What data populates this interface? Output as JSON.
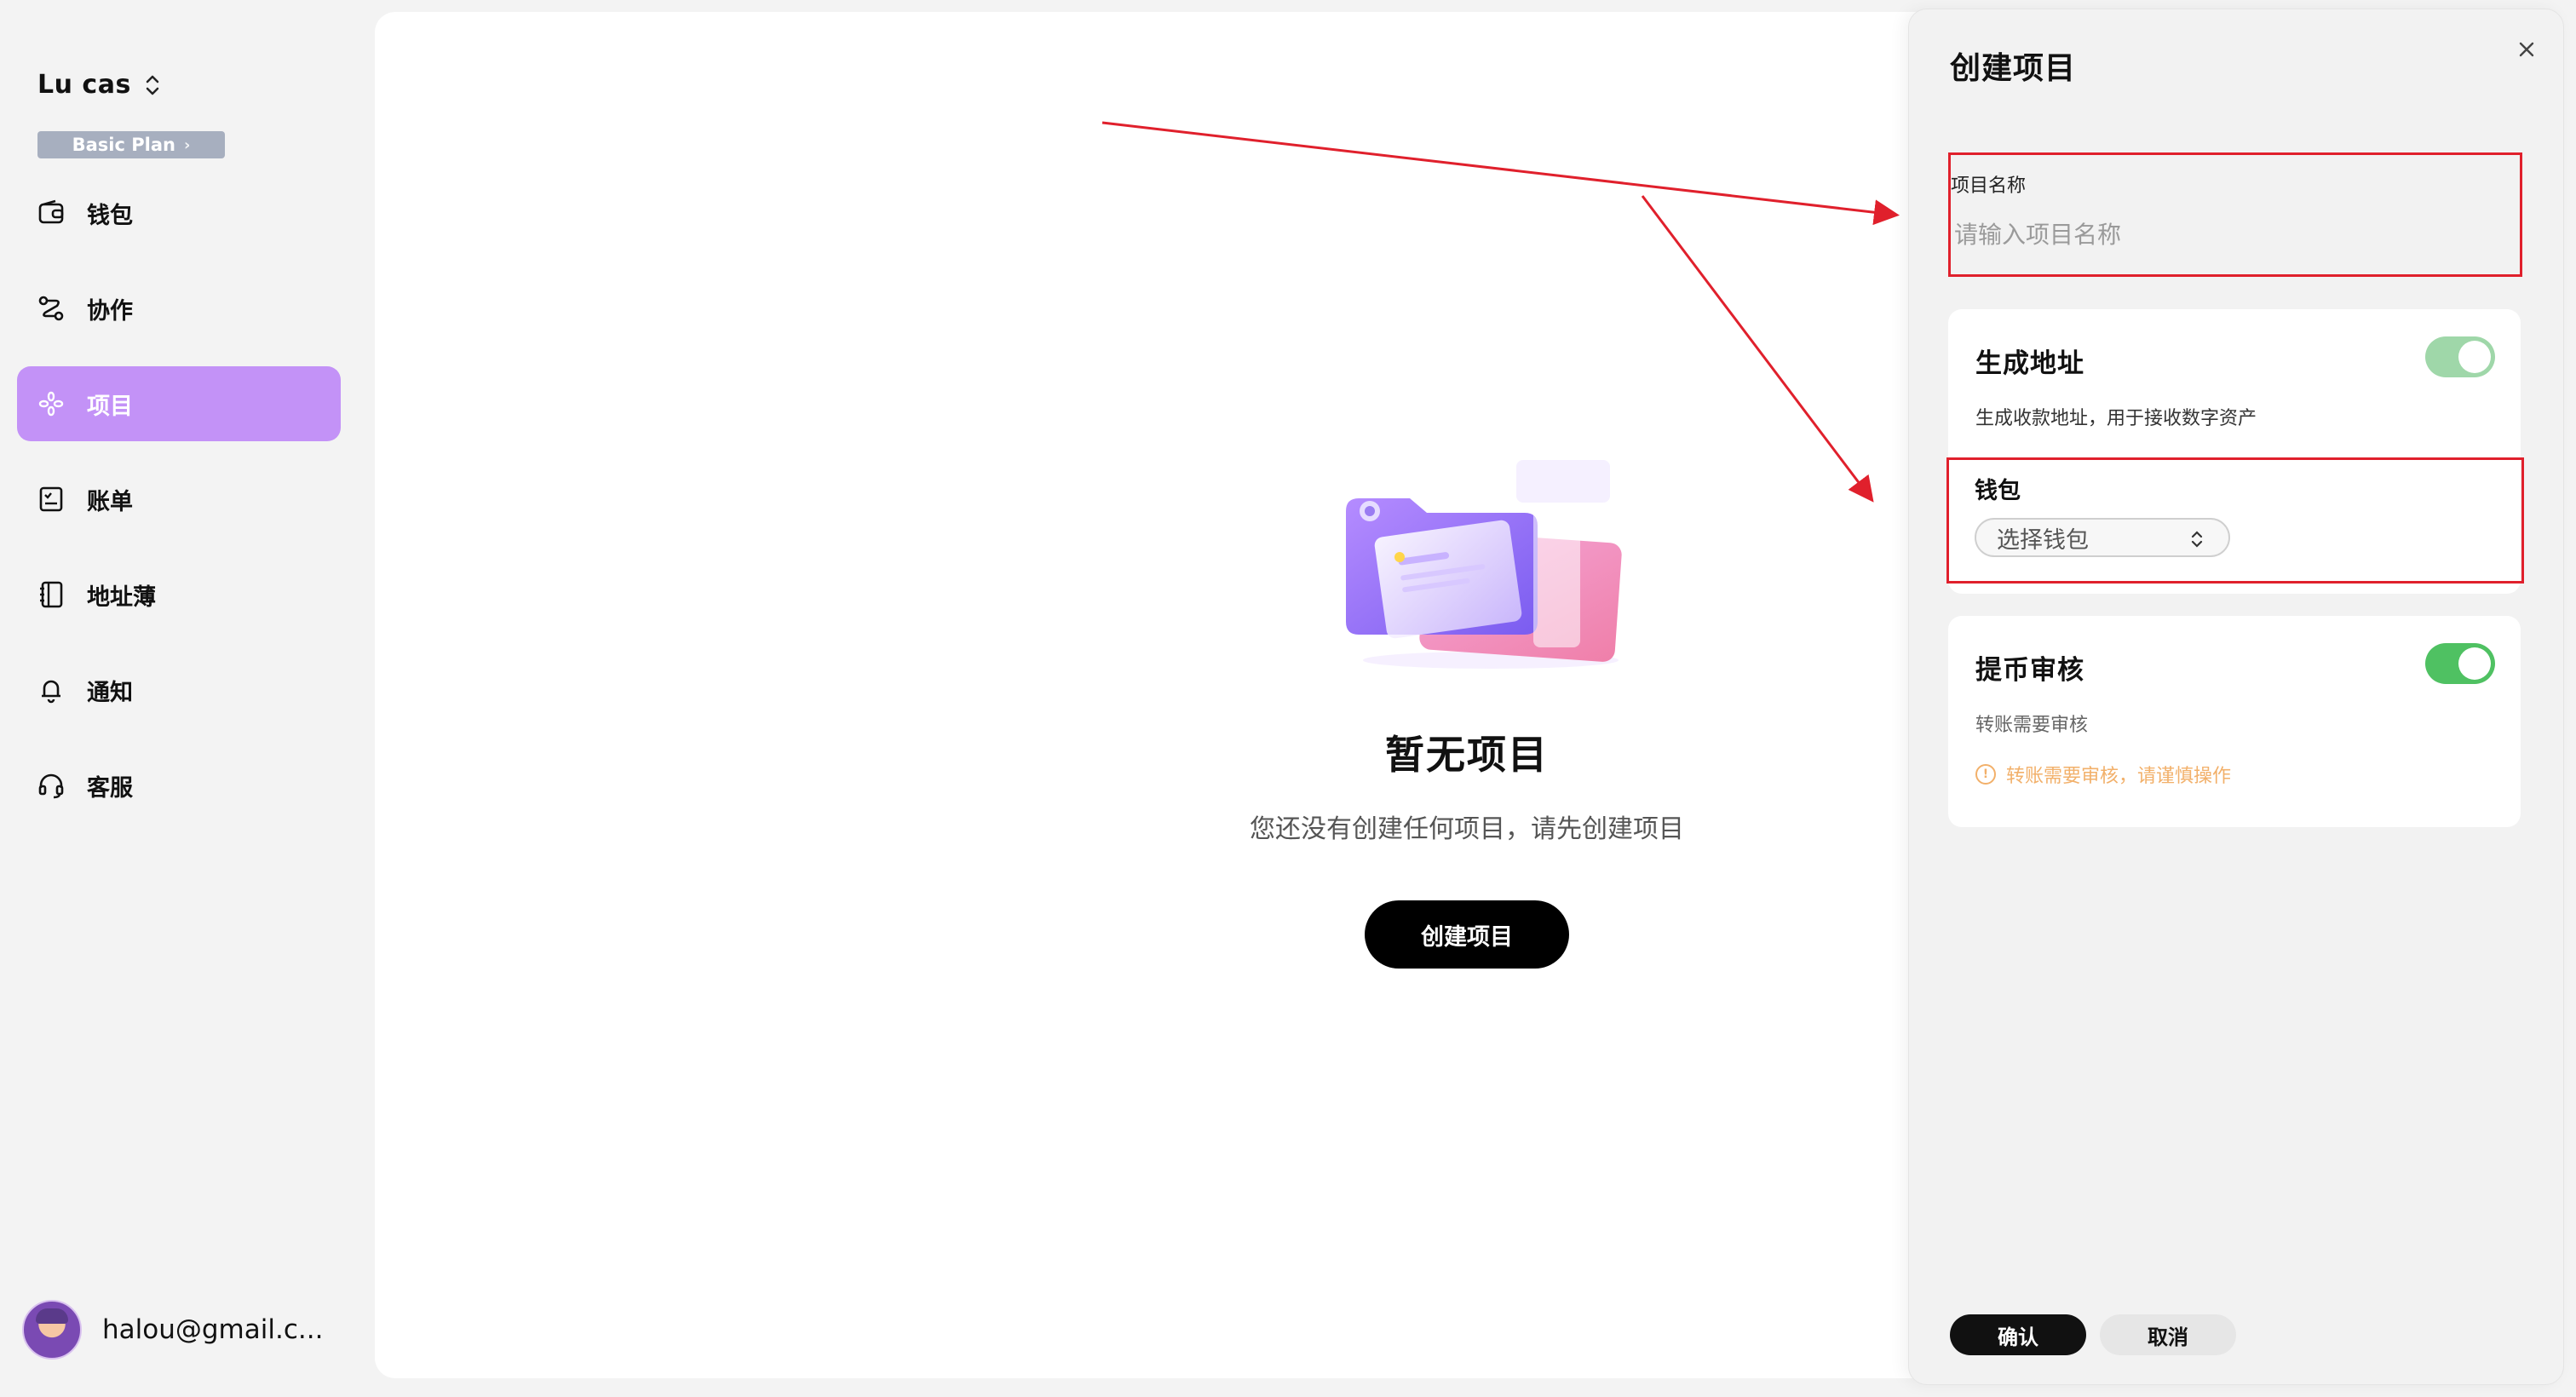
{
  "sidebar": {
    "account_name": "Lu cas",
    "plan": "Basic Plan",
    "items": [
      {
        "label": "钱包",
        "icon": "wallet-icon"
      },
      {
        "label": "协作",
        "icon": "collaboration-icon"
      },
      {
        "label": "项目",
        "icon": "project-icon",
        "active": true
      },
      {
        "label": "账单",
        "icon": "bill-icon"
      },
      {
        "label": "地址薄",
        "icon": "address-book-icon"
      },
      {
        "label": "通知",
        "icon": "bell-icon"
      },
      {
        "label": "客服",
        "icon": "headset-icon"
      }
    ],
    "user_email": "halou@gmail.c..."
  },
  "main": {
    "empty_title": "暂无项目",
    "empty_desc": "您还没有创建任何项目，请先创建项目",
    "create_button": "创建项目"
  },
  "drawer": {
    "title": "创建项目",
    "name_label": "项目名称",
    "name_placeholder": "请输入项目名称",
    "address_card": {
      "title": "生成地址",
      "toggle_on": true,
      "subtitle": "生成收款地址，用于接收数字资产",
      "wallet_label": "钱包",
      "wallet_placeholder": "选择钱包"
    },
    "audit_card": {
      "title": "提币审核",
      "toggle_on": true,
      "subtitle": "转账需要审核",
      "warning": "转账需要审核，请谨慎操作"
    },
    "confirm_button": "确认",
    "cancel_button": "取消"
  },
  "colors": {
    "active_nav": "#c392f7",
    "toggle_green": "#4fc162",
    "annotation_red": "#e0202c",
    "warning_orange": "#f2b06a"
  }
}
